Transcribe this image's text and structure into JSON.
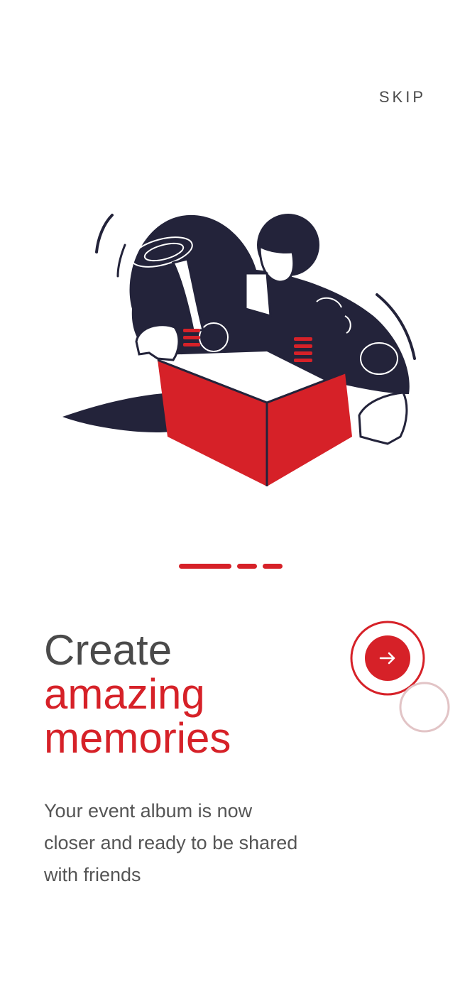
{
  "header": {
    "skip_label": "SKIP"
  },
  "onboarding": {
    "title_line1": "Create",
    "title_line2": "amazing",
    "title_line3": "memories",
    "description": "Your event album is now closer and ready to be shared with friends",
    "current_page": 1,
    "total_pages": 3
  },
  "colors": {
    "accent": "#d62128",
    "navy": "#23233a",
    "text_dark": "#4a4a4a",
    "text_body": "#555555"
  },
  "icons": {
    "next": "arrow-right-icon"
  }
}
